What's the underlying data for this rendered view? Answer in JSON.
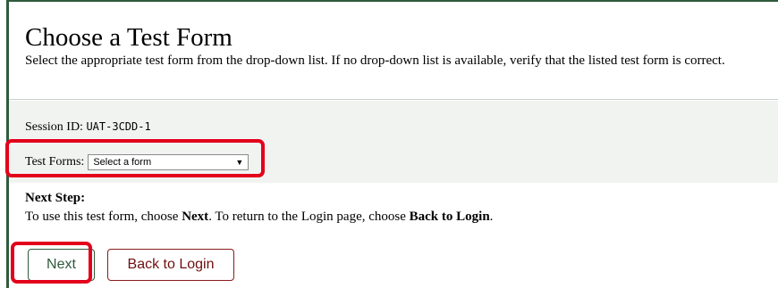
{
  "header": {
    "title": "Choose a Test Form",
    "instructions": "Select the appropriate test form from the drop-down list. If no drop-down list is available, verify that the listed test form is correct."
  },
  "session": {
    "label": "Session ID:",
    "value": "UAT-3CDD-1"
  },
  "test_forms": {
    "label": "Test Forms:",
    "selected": "Select a form"
  },
  "next_step": {
    "title": "Next Step:",
    "text_1": "To use this test form, choose ",
    "next_word": "Next",
    "text_2": ". To return to the Login page, choose ",
    "back_word": "Back to Login",
    "text_3": "."
  },
  "buttons": {
    "next_label": "Next",
    "back_label": "Back to Login"
  },
  "colors": {
    "border_green": "#2e5a3b",
    "highlight_red": "#e3001b",
    "button_text": "#6e1010"
  }
}
